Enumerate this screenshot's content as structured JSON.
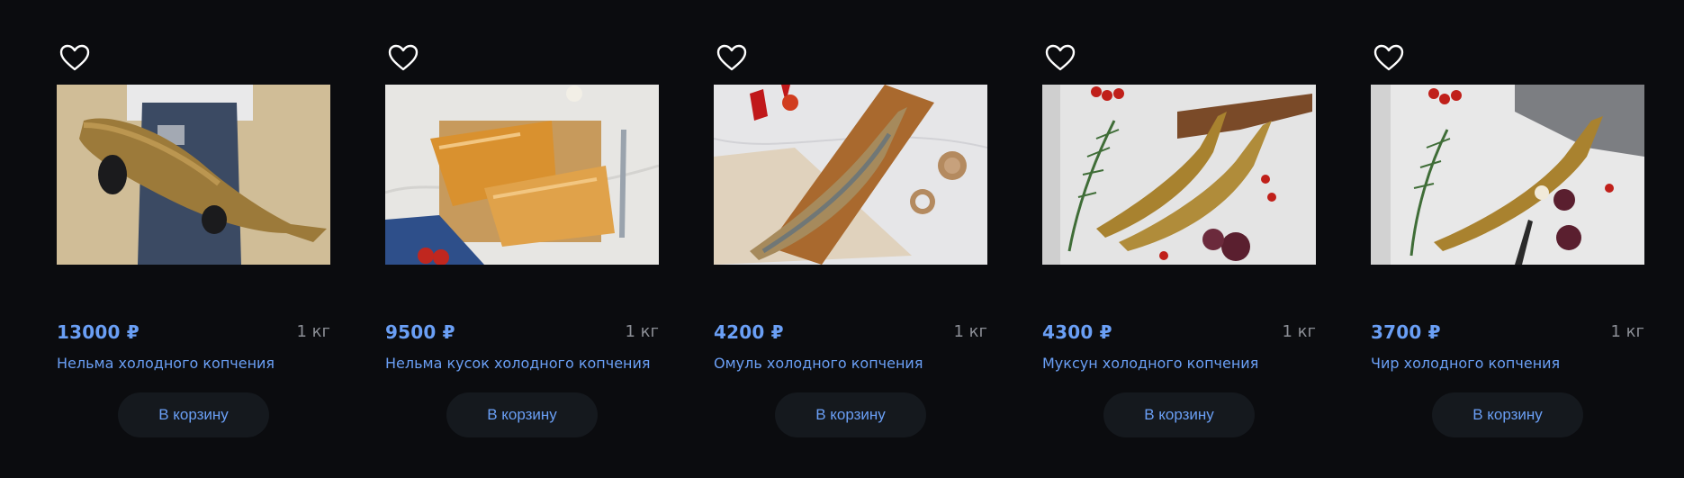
{
  "products": [
    {
      "name": "Нельма холодного копчения",
      "price": "13000 ₽",
      "weight": "1 кг",
      "cart_label": "В корзину",
      "image_icon": "nelma-whole-fish-photo",
      "favorite_icon": "heart-outline-icon"
    },
    {
      "name": "Нельма кусок холодного копчения",
      "price": "9500 ₽",
      "weight": "1 кг",
      "cart_label": "В корзину",
      "image_icon": "nelma-fillet-photo",
      "favorite_icon": "heart-outline-icon"
    },
    {
      "name": "Омуль холодного копчения",
      "price": "4200 ₽",
      "weight": "1 кг",
      "cart_label": "В корзину",
      "image_icon": "omul-fish-photo",
      "favorite_icon": "heart-outline-icon"
    },
    {
      "name": "Муксун холодного копчения",
      "price": "4300 ₽",
      "weight": "1 кг",
      "cart_label": "В корзину",
      "image_icon": "muksun-fish-photo",
      "favorite_icon": "heart-outline-icon"
    },
    {
      "name": "Чир холодного копчения",
      "price": "3700 ₽",
      "weight": "1 кг",
      "cart_label": "В корзину",
      "image_icon": "chir-fish-photo",
      "favorite_icon": "heart-outline-icon"
    }
  ],
  "colors": {
    "background": "#0b0c0f",
    "accent": "#6a9ff5",
    "muted": "#8c8f96",
    "button_bg": "#15191e"
  }
}
